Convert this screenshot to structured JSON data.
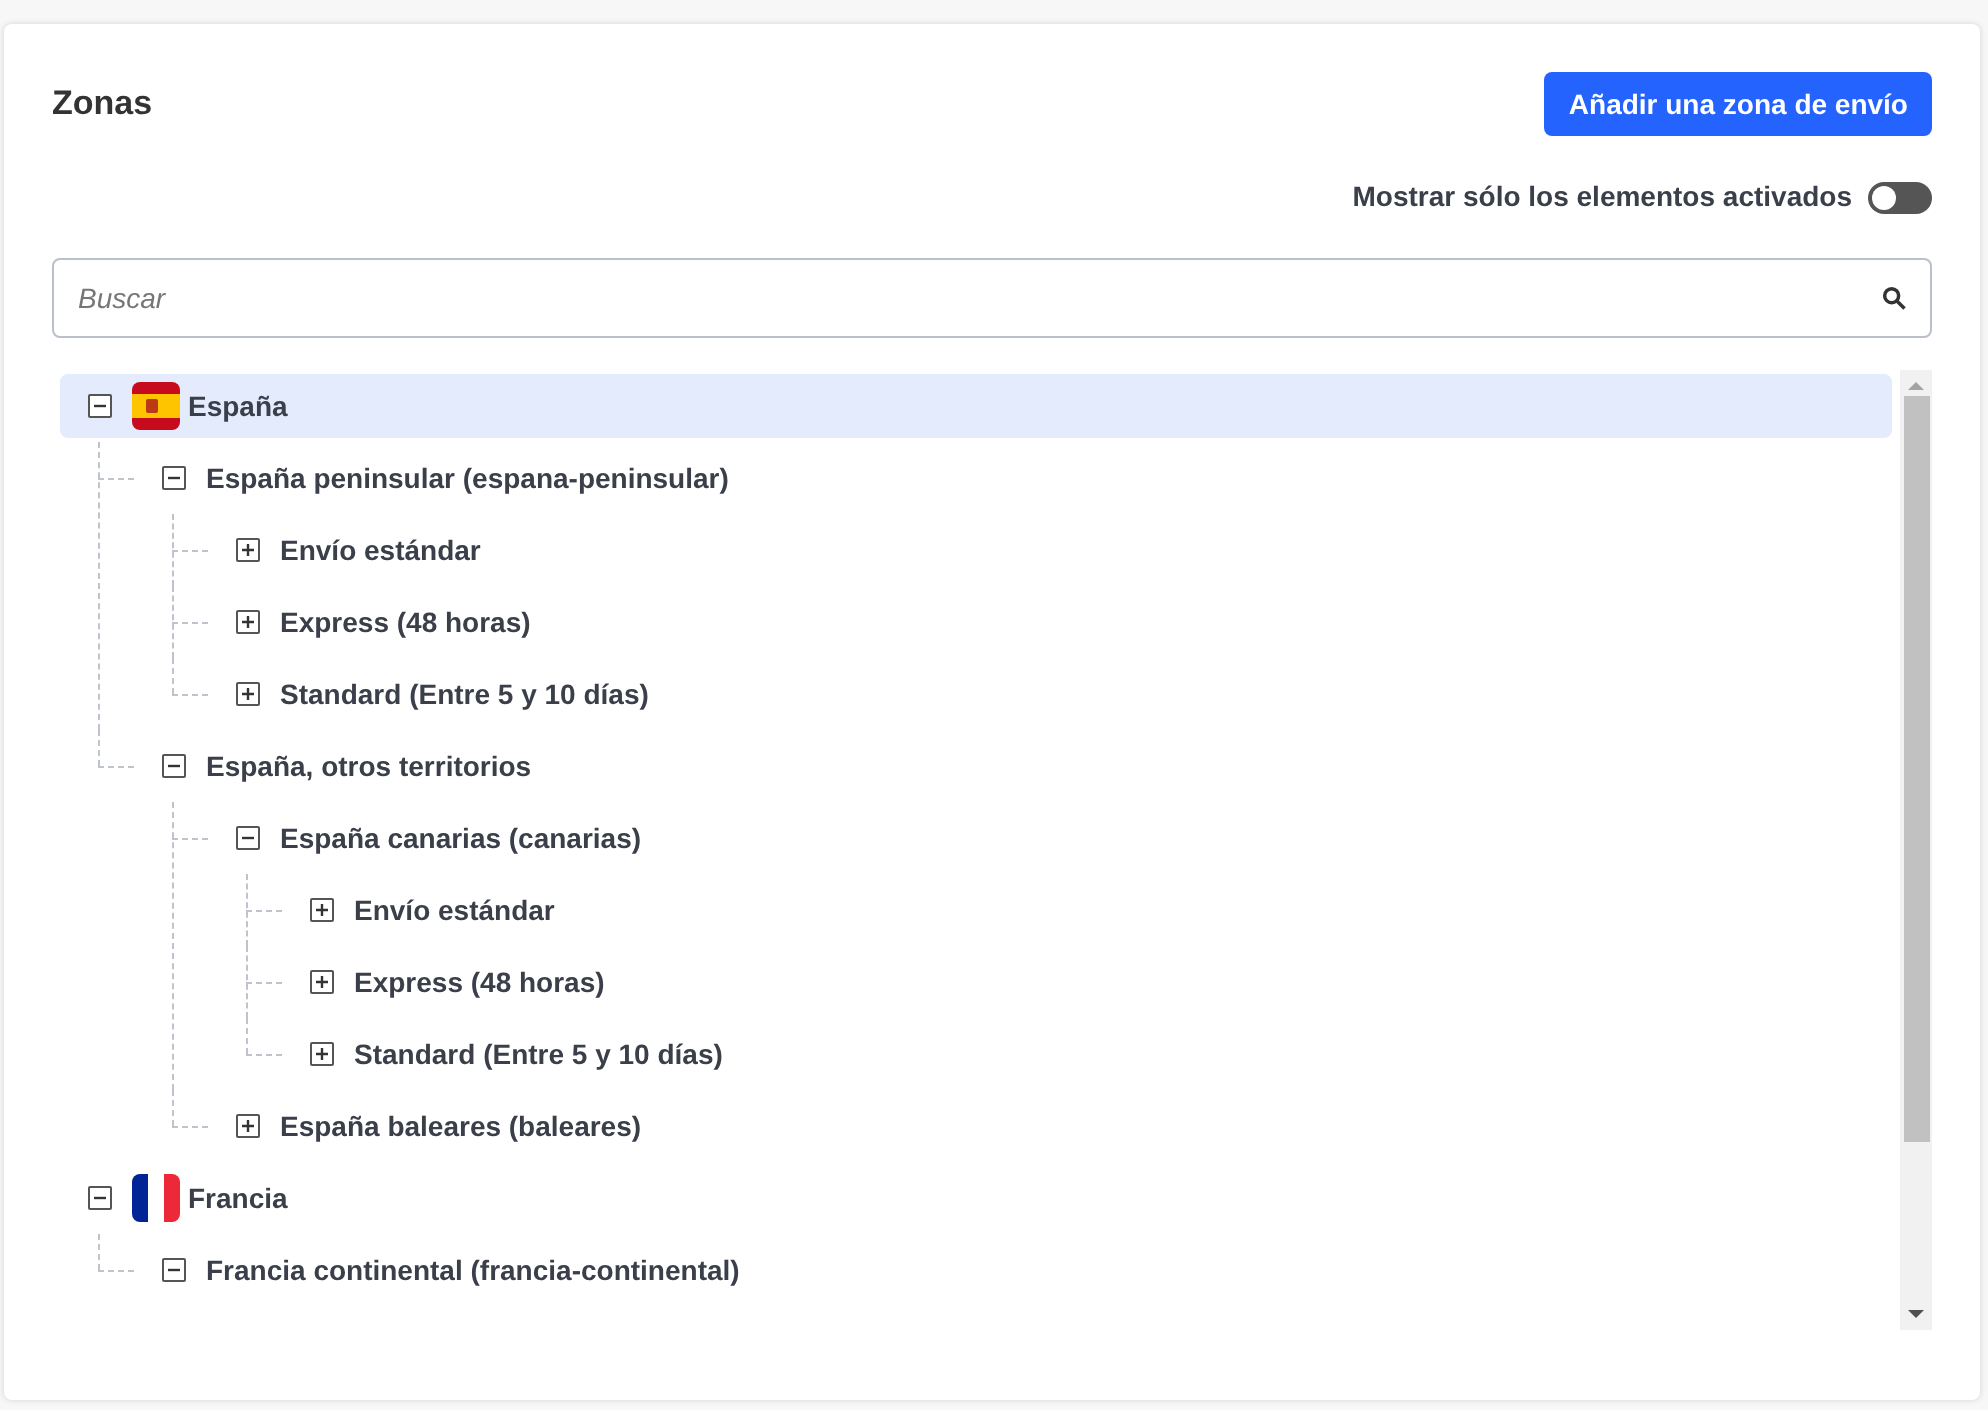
{
  "header": {
    "title": "Zonas",
    "add_button": "Añadir una zona de envío"
  },
  "filter": {
    "label": "Mostrar sólo los elementos activados",
    "on": false
  },
  "search": {
    "placeholder": "Buscar"
  },
  "tree": [
    {
      "label": "España",
      "kind": "es",
      "expanded": true,
      "selected": true,
      "children": [
        {
          "label": "España peninsular (espana-peninsular)",
          "expanded": true,
          "selected": false,
          "children": [
            {
              "label": "Envío estándar",
              "expanded": false,
              "selected": false
            },
            {
              "label": "Express (48 horas)",
              "expanded": false,
              "selected": false
            },
            {
              "label": "Standard (Entre 5 y 10 días)",
              "expanded": false,
              "selected": false
            }
          ]
        },
        {
          "label": "España, otros territorios",
          "expanded": true,
          "selected": false,
          "children": [
            {
              "label": "España canarias (canarias)",
              "expanded": true,
              "selected": false,
              "children": [
                {
                  "label": "Envío estándar",
                  "expanded": false,
                  "selected": false
                },
                {
                  "label": "Express (48 horas)",
                  "expanded": false,
                  "selected": false
                },
                {
                  "label": "Standard (Entre 5 y 10 días)",
                  "expanded": false,
                  "selected": false
                }
              ]
            },
            {
              "label": "España baleares (baleares)",
              "expanded": false,
              "selected": false
            }
          ]
        }
      ]
    },
    {
      "label": "Francia",
      "kind": "fr",
      "expanded": true,
      "selected": false,
      "children": [
        {
          "label": "Francia continental (francia-continental)",
          "expanded": true,
          "selected": false
        }
      ]
    }
  ]
}
